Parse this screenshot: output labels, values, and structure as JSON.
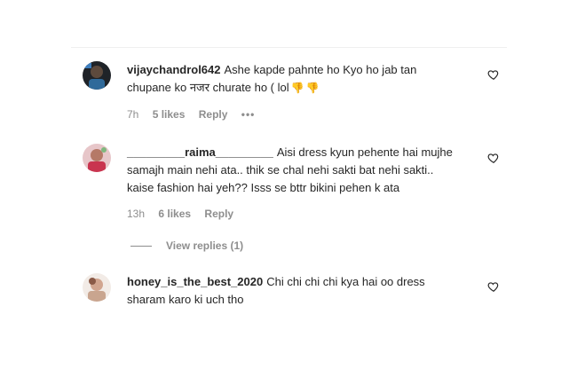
{
  "comments": [
    {
      "username": "vijaychandrol642",
      "text": "Ashe kapde pahnte ho Kyo ho jab tan chupane ko नजर churate ho ( lol",
      "emoji": [
        "👎",
        "👎"
      ],
      "time": "7h",
      "likes": "5 likes",
      "reply": "Reply",
      "more": "•••",
      "avatar_color": "#3a3f4b"
    },
    {
      "username": "_________raima_________",
      "text": "Aisi dress kyun pehente hai mujhe samajh main nehi ata.. thik se chal nehi sakti bat nehi sakti.. kaise fashion hai yeh?? Isss se bttr bikini pehen k ata",
      "time": "13h",
      "likes": "6 likes",
      "reply": "Reply",
      "view_replies": "View replies (1)",
      "avatar_color": "#c98f96"
    },
    {
      "username": "honey_is_the_best_2020",
      "text": "Chi chi chi chi kya hai oo dress sharam karo ki uch tho",
      "avatar_color": "#d7b8a6"
    }
  ],
  "icons": {
    "like": "heart-outline-icon"
  }
}
